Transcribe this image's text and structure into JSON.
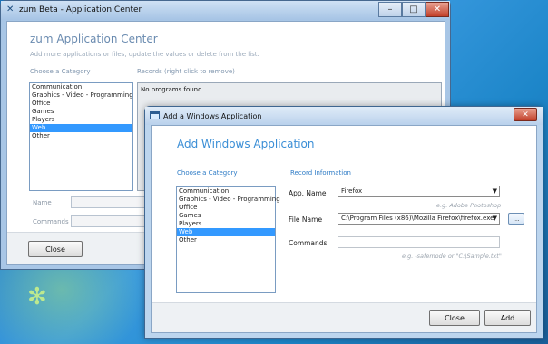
{
  "back_window": {
    "title": "zum Beta - Application Center",
    "heading": "zum Application Center",
    "subtitle": "Add more applications or files, update the values or delete from the list.",
    "category_label": "Choose a Category",
    "records_label": "Records (right click to remove)",
    "records_empty": "No programs found.",
    "categories": [
      "Communication",
      "Graphics - Video - Programming",
      "Office",
      "Games",
      "Players",
      "Web",
      "Other"
    ],
    "name_label": "Name",
    "commands_label": "Commands",
    "close_button": "Close",
    "window_buttons": {
      "minimize": "–",
      "maximize": "□",
      "close": "✕"
    }
  },
  "dialog": {
    "title": "Add a Windows Application",
    "heading": "Add Windows Application",
    "category_label": "Choose a Category",
    "record_label": "Record Information",
    "categories": [
      "Communication",
      "Graphics - Video - Programming",
      "Office",
      "Games",
      "Players",
      "Web",
      "Other"
    ],
    "selected_category": "Web",
    "app_name_label": "App. Name",
    "app_name_value": "Firefox",
    "app_name_hint": "e.g. Adobe Photoshop",
    "file_name_label": "File Name",
    "file_name_value": "C:\\Program Files (x86)\\Mozilla Firefox\\firefox.exe",
    "browse_label": "...",
    "commands_label": "Commands",
    "commands_value": "",
    "commands_hint": "e.g. -safemode or \"C:\\Sample.txt\"",
    "close_button": "Close",
    "add_button": "Add",
    "close_glyph": "✕",
    "combo_arrow": "▼"
  },
  "colors": {
    "selection": "#3399ff",
    "dialog_heading": "#3a8ed6",
    "desktop": "#2a86cf"
  },
  "icons": [
    "app-icon",
    "dialog-icon",
    "close-icon",
    "minimize-icon",
    "maximize-icon",
    "dropdown-arrow-icon",
    "desktop-logo-icon"
  ]
}
